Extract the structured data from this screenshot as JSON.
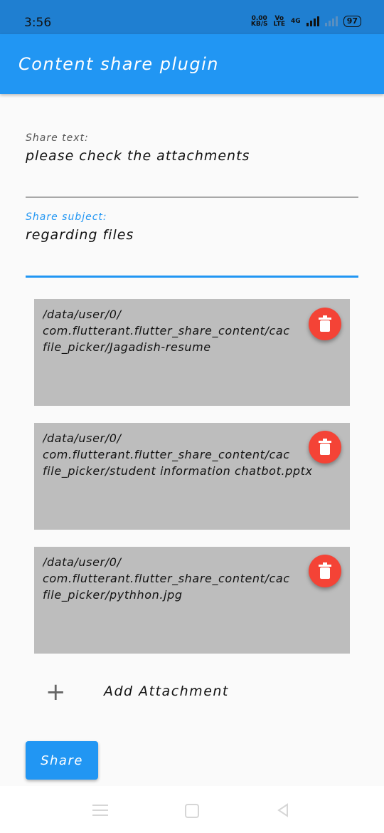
{
  "status": {
    "time": "3:56",
    "speed_value": "0.00",
    "speed_unit": "KB/S",
    "volte_top": "Vo",
    "volte_bottom": "LTE",
    "network": "4G",
    "battery": "97"
  },
  "appbar": {
    "title": "Content share plugin"
  },
  "share_text": {
    "label": "Share text:",
    "value": "please check the attachments"
  },
  "share_subject": {
    "label": "Share subject:",
    "value": "regarding files"
  },
  "attachments": [
    {
      "line1": "/data/user/0/",
      "line2": "com.flutterant.flutter_share_content/cac",
      "line3": "file_picker/Jagadish-resume"
    },
    {
      "line1": "/data/user/0/",
      "line2": "com.flutterant.flutter_share_content/cac",
      "line3": "file_picker/student information chatbot.pptx"
    },
    {
      "line1": "/data/user/0/",
      "line2": "com.flutterant.flutter_share_content/cac",
      "line3": "file_picker/pythhon.jpg"
    }
  ],
  "add_attachment": {
    "label": "Add Attachment"
  },
  "share_button": {
    "label": "Share"
  },
  "colors": {
    "primary": "#2196f3",
    "delete": "#f44336",
    "card": "#bdbdbd"
  },
  "icons": {
    "delete": "trash-icon",
    "add": "plus-icon"
  }
}
